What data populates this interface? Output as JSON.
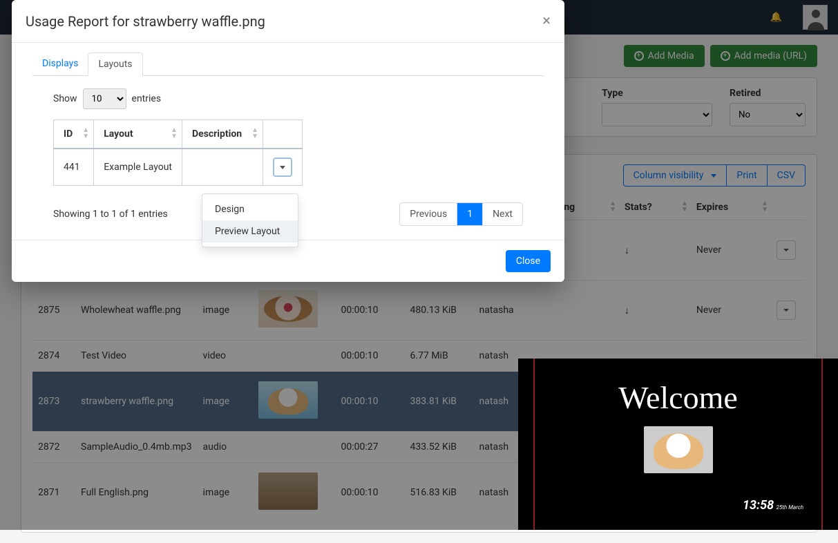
{
  "navbar": {
    "bell_icon": "🔔"
  },
  "actions": {
    "add_media": "Add Media",
    "add_media_url": "Add media (URL)"
  },
  "filters": {
    "type_label": "Type",
    "retired_label": "Retired",
    "retired_value": "No"
  },
  "toolbar": {
    "colvis": "Column visibility",
    "print": "Print",
    "csv": "CSV"
  },
  "media_table": {
    "headers": {
      "sharing": "Sharing",
      "stats": "Stats?",
      "expires": "Expires"
    },
    "rows": [
      {
        "id": "",
        "name": "",
        "type": "",
        "duration": "",
        "size": "",
        "owner": "",
        "stats_icon": "↓",
        "expires": "Never",
        "thumb": "th-grey"
      },
      {
        "id": "2875",
        "name": "Wholewheat waffle.png",
        "type": "image",
        "duration": "00:00:10",
        "size": "480.13 KiB",
        "owner": "natasha",
        "stats_icon": "↓",
        "expires": "Never",
        "thumb": "th-fruit"
      },
      {
        "id": "2874",
        "name": "Test Video",
        "type": "video",
        "duration": "00:00:10",
        "size": "6.77 MiB",
        "owner": "natash",
        "stats_icon": "",
        "expires": "",
        "thumb": ""
      },
      {
        "id": "2873",
        "name": "strawberry waffle.png",
        "type": "image",
        "duration": "00:00:10",
        "size": "383.81 KiB",
        "owner": "natash",
        "stats_icon": "",
        "expires": "",
        "thumb": "th-cream",
        "hl": true
      },
      {
        "id": "2872",
        "name": "SampleAudio_0.4mb.mp3",
        "type": "audio",
        "duration": "00:00:27",
        "size": "433.52 KiB",
        "owner": "natash",
        "stats_icon": "",
        "expires": "",
        "thumb": ""
      },
      {
        "id": "2871",
        "name": "Full English.png",
        "type": "image",
        "duration": "00:00:10",
        "size": "516.83 KiB",
        "owner": "natash",
        "stats_icon": "",
        "expires": "",
        "thumb": "th-break"
      }
    ]
  },
  "modal": {
    "title": "Usage Report for strawberry waffle.png",
    "tabs": {
      "displays": "Displays",
      "layouts": "Layouts"
    },
    "show_label": "Show",
    "entries_label": "entries",
    "page_len": "10",
    "headers": {
      "id": "ID",
      "layout": "Layout",
      "description": "Description"
    },
    "row": {
      "id": "441",
      "layout": "Example Layout",
      "description": ""
    },
    "info": "Showing 1 to 1 of 1 entries",
    "pager": {
      "prev": "Previous",
      "page": "1",
      "next": "Next"
    },
    "close": "Close",
    "menu": {
      "design": "Design",
      "preview": "Preview Layout"
    }
  },
  "preview": {
    "welcome": "Welcome",
    "clock": "13:58",
    "clock_sub": "25th March"
  }
}
